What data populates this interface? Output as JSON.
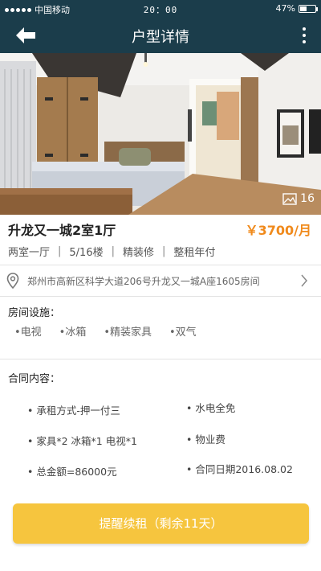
{
  "status_bar": {
    "carrier": "中国移动",
    "time": "20：00",
    "battery_text": "47%",
    "battery_level": 0.47
  },
  "nav": {
    "title": "户型详情",
    "back_icon": "arrow-left-icon",
    "more_icon": "more-vertical-icon"
  },
  "photo": {
    "count": "16",
    "icon": "image-gallery-icon"
  },
  "listing": {
    "title": "升龙又一城2室1厅",
    "price": "￥3700/月",
    "price_color": "#f08a1c",
    "tags": [
      "两室一厅",
      "5/16楼",
      "精装修",
      "整租年付"
    ],
    "address": "郑州市高新区科学大道206号升龙又一城A座1605房间"
  },
  "facilities": {
    "title": "房间设施：",
    "items": [
      "•电视",
      "•冰箱",
      "•精装家具",
      "•双气"
    ]
  },
  "contract": {
    "title": "合同内容：",
    "items": [
      "•  承租方式-押一付三",
      "•  水电全免",
      "•  家具*2    冰箱*1    电视*1",
      "•  物业费",
      "•  总金额=86000元",
      "•  合同日期2016.08.02"
    ]
  },
  "action": {
    "remind_label": "提醒续租（剩余11天）",
    "button_color": "#f6c53e"
  },
  "theme": {
    "header_color": "#1b3d4b"
  }
}
